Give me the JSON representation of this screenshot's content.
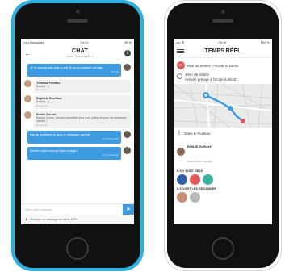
{
  "chat_app": {
    "status": {
      "carrier": "••••• Bouygues",
      "time": "14:14",
      "battery": "36 %"
    },
    "header": {
      "title": "CHAT",
      "subtitle": "Ligne Rosqueuille 2"
    },
    "my_message_1": {
      "text": "Je ne pourrai pas venir la nuit, je veux transférer qui sait...",
      "time": "8 jours"
    },
    "messages": [
      {
        "name": "Thomas Petitfils",
        "text": "Bonjour :-)",
        "time": "8 s, ajouté"
      },
      {
        "name": "Baptiste Bouffaut",
        "text": "Bonjour :-)",
        "time": "8 s, ajouté"
      },
      {
        "name": "Emilie Durant",
        "text": "Bonjour à tous, demain impossible pour moi, quelqu'un peut me remplacer samedi ?",
        "time": "8 s, ajouté"
      }
    ],
    "my_message_2": {
      "text": "Pas de problème, je peux te remplacer samedi",
      "time": "Il y a 5 minutes"
    },
    "my_message_3": {
      "text": "Dernier chant vous qui lavez chargé !",
      "time": "Il y a 3 minutes"
    },
    "compose_placeholder": "Tapez votre message",
    "alert_text": "Envoyer un message en alerte SMS"
  },
  "realtime_app": {
    "status": {
      "carrier": "•••• ☰",
      "time": "09:16",
      "battery": "100 %"
    },
    "header": {
      "title": "TEMPS RÉEL"
    },
    "route": {
      "badge": "P1",
      "text": "Rue du Sentier > Ecole St Denis"
    },
    "delay": {
      "line1": "3min de retard",
      "line2": "Arrivée prévue à l'école à 8h23"
    },
    "dans_le": "Dans le Pedibus :",
    "driver": {
      "name": "ÉMILIE DURANT",
      "sub": "Vérifié à 8h19 (via app)"
    },
    "section_on_board": "ILS Y SONT DÉJÀ",
    "section_to_join": "ILS VONT LES REJOINDRE"
  },
  "colors": {
    "accent_blue": "#3f9be0",
    "phone_blue": "#2fb0e2",
    "badge_red": "#e8555a"
  }
}
